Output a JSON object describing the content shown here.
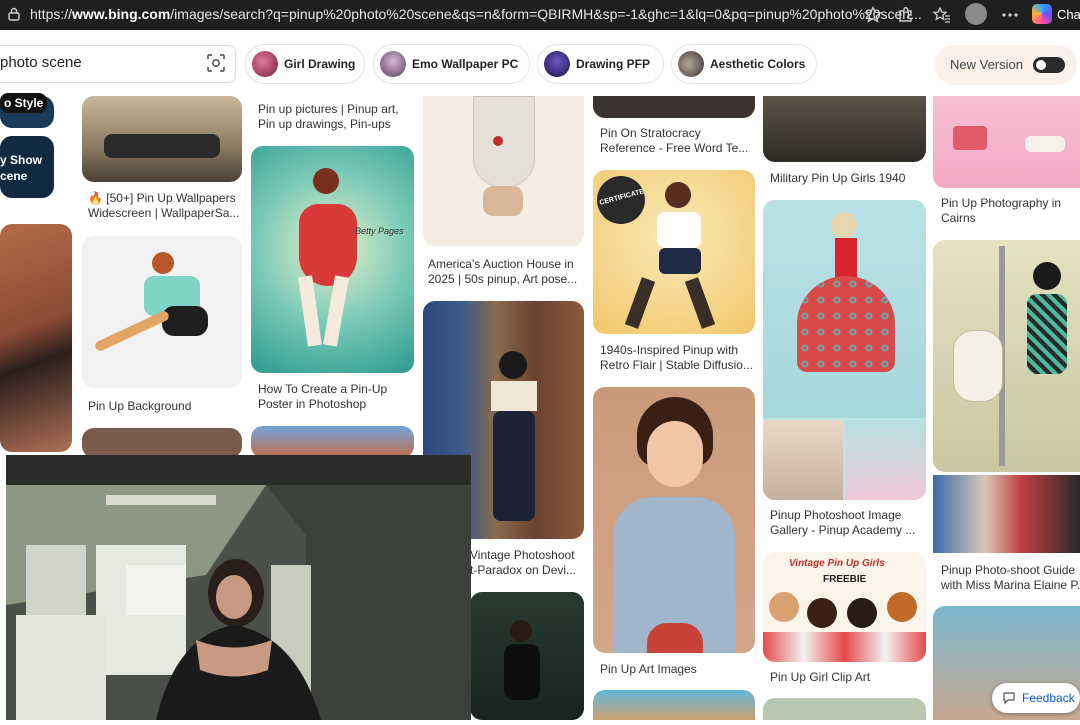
{
  "browser": {
    "url_prefix": "https://",
    "url_host": "www.bing.com",
    "url_rest": "/images/search?q=pinup%20photo%20scene&qs=n&form=QBIRMH&sp=-1&ghc=1&lq=0&pq=pinup%20photo%20scen...",
    "chat_label": "Chat"
  },
  "search": {
    "query": "photo scene"
  },
  "related_pills": [
    {
      "label": "Girl Drawing"
    },
    {
      "label": "Emo Wallpaper PC"
    },
    {
      "label": "Drawing PFP"
    },
    {
      "label": "Aesthetic Colors"
    }
  ],
  "toggle": {
    "label": "New Version",
    "state": "off"
  },
  "side_chips": {
    "chip1": "o Style",
    "chip2a": "y Show",
    "chip2b": "cene"
  },
  "captions": {
    "c2a": "🔥 [50+] Pin Up Wallpapers",
    "c2b": "Widescreen | WallpaperSa...",
    "c2c": "Pin Up Background",
    "c3a": "Pin up pictures | Pinup art,",
    "c3b": "Pin up drawings, Pin-ups",
    "c3c": "How To Create a Pin-Up",
    "c3d": "Poster in Photoshop",
    "c4a": "America's Auction House in",
    "c4b": "2025 | 50s pinup, Art pose...",
    "c4c": "Vintage Photoshoot",
    "c4d": "t-Paradox on Devi...",
    "c5a": "Pin On Stratocracy",
    "c5b": "Reference - Free Word Te...",
    "c5c": "1940s-Inspired Pinup with",
    "c5d": "Retro Flair | Stable Diffusio...",
    "c5e": "Pin Up Art Images",
    "c6a": "Military Pin Up Girls 1940",
    "c6b": "Pinup Photoshoot Image",
    "c6c": "Gallery - Pinup Academy ...",
    "c6d": "Pin Up Girl Clip Art",
    "c7a": "Pin Up Photography in",
    "c7b": "Cairns",
    "c7c": "Pinup Photo-shoot Guide",
    "c7d": "with Miss Marina Elaine P..."
  },
  "image_text": {
    "certificate": "CERTIFICATE",
    "betty": "Betty Pages",
    "vintage": "Vintage Pin Up Girls",
    "freebie": "FREEBIE"
  },
  "feedback": {
    "label": "Feedback"
  },
  "colors": {
    "address_bar_bg": "#1f1f1f",
    "toggle_bg": "#fbf0ea",
    "feedback_text": "#0b57d0",
    "grid_caption": "#333333"
  },
  "icons": {
    "lock": "lock-icon",
    "star": "star-icon",
    "extensions": "puzzle-icon",
    "favorites": "favorites-icon",
    "profile": "profile-icon",
    "menu": "more-icon",
    "copilot": "copilot-icon",
    "visual_search": "camera-search-icon",
    "feedback": "feedback-icon"
  }
}
